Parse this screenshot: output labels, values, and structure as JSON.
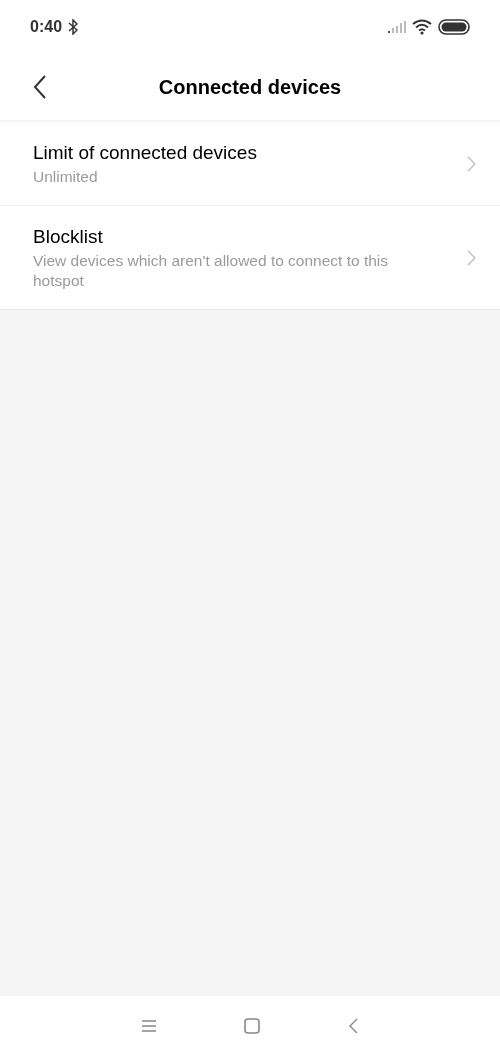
{
  "status_bar": {
    "time": "0:40"
  },
  "header": {
    "title": "Connected devices"
  },
  "items": [
    {
      "title": "Limit of connected devices",
      "summary": "Unlimited"
    },
    {
      "title": "Blocklist",
      "summary": "View devices which aren't allowed to connect to this hotspot"
    }
  ]
}
